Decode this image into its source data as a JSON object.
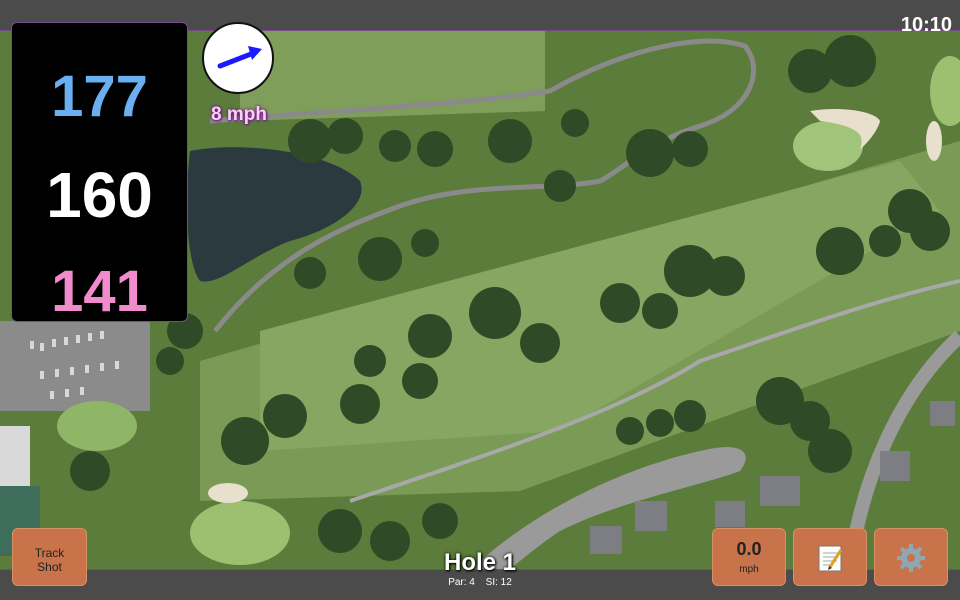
{
  "status": {
    "clock": "10:10"
  },
  "distances": {
    "back": "177",
    "middle": "160",
    "front": "141"
  },
  "wind": {
    "speed_label": "8 mph",
    "icon": "wind-direction-arrow-icon"
  },
  "hole": {
    "title": "Hole 1",
    "par": "Par: 4",
    "stroke_index": "SI: 12"
  },
  "buttons": {
    "track_shot_line1": "Track",
    "track_shot_line2": "Shot",
    "speed_value": "0.0",
    "speed_unit": "mph",
    "notes_icon": "notepad-icon",
    "settings_icon": "gear-icon"
  },
  "colors": {
    "back_distance": "#6ab0f0",
    "middle_distance": "#ffffff",
    "front_distance": "#f08ccc",
    "button_bg": "#c8734a",
    "panel_bg": "#000000",
    "accent_border": "#7a4a8a"
  }
}
